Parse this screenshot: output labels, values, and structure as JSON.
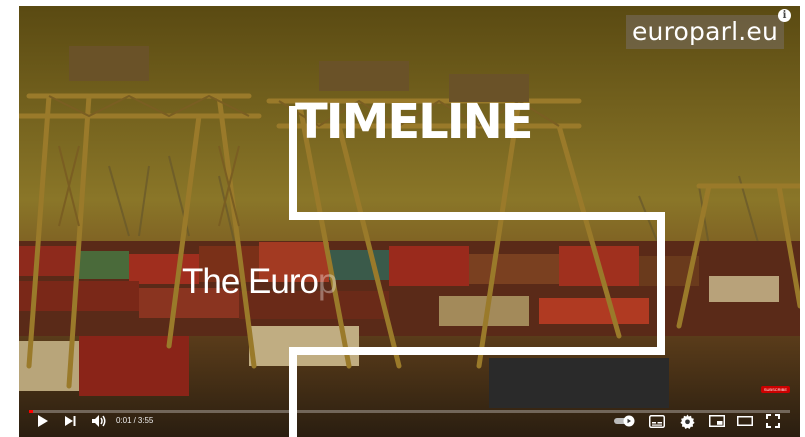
{
  "overlay": {
    "brand": "europarl.eu",
    "info_icon": "info-icon",
    "title": "TIMELINE",
    "subtitle_visible": "The Euro",
    "subtitle_fading": "p"
  },
  "player": {
    "current_time": "0:01",
    "separator": "/",
    "duration": "3:55",
    "progress_fraction": 0.005,
    "accent": "#ff0000",
    "subscribe_label": "SUBSCRIBE",
    "icons": [
      "play-icon",
      "next-icon",
      "volume-icon",
      "autoplay-toggle-icon",
      "subtitles-icon",
      "settings-icon",
      "miniplayer-icon",
      "theater-icon",
      "fullscreen-icon"
    ]
  },
  "colors": {
    "tint": "#8a7422",
    "containers_red": "#9a2a1e",
    "line_white": "#ffffff"
  }
}
